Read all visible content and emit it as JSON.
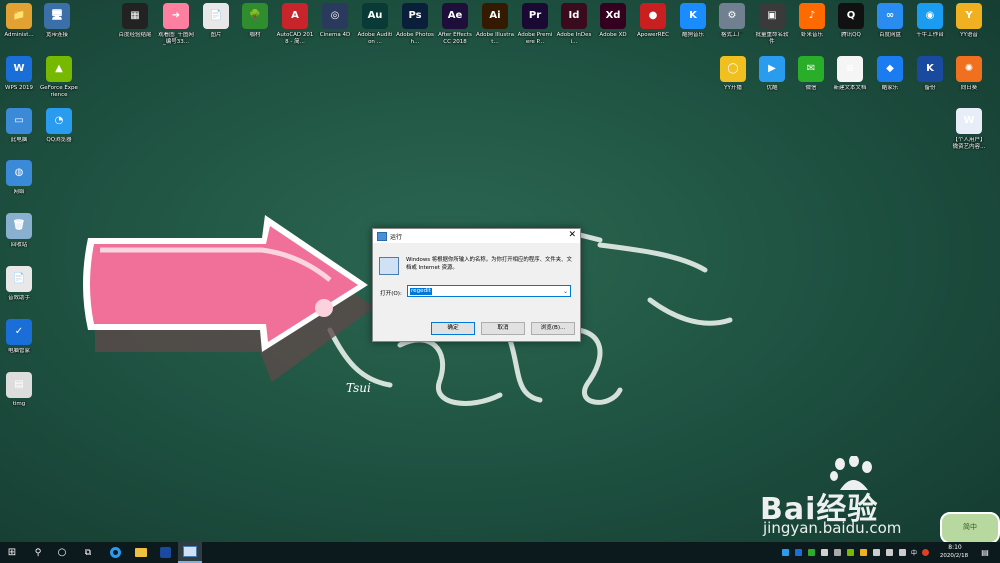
{
  "desktop": {
    "icons": [
      {
        "label": "Administ...",
        "glyph": "📁",
        "color": "#e2a233"
      },
      {
        "label": "宽带连接",
        "glyph": "🖥",
        "color": "#3b6fa8"
      },
      {
        "label": "百度经验结尾",
        "glyph": "▦",
        "color": "#222222"
      },
      {
        "label": "观看图_千图网_编号33...",
        "glyph": "➜",
        "color": "#ff7fa0"
      },
      {
        "label": "图片",
        "glyph": "📄",
        "color": "#e8e8e8"
      },
      {
        "label": "咖村",
        "glyph": "🌳",
        "color": "#2f8c2f"
      },
      {
        "label": "AutoCAD 2018 - 简...",
        "glyph": "A",
        "color": "#c8242c"
      },
      {
        "label": "Cinema 4D",
        "glyph": "◎",
        "color": "#2a3a5c"
      },
      {
        "label": "Adobe Audition ...",
        "glyph": "Au",
        "color": "#0a3a35"
      },
      {
        "label": "Adobe Photosh...",
        "glyph": "Ps",
        "color": "#0a1f3a"
      },
      {
        "label": "After Effects CC 2018",
        "glyph": "Ae",
        "color": "#1e0f3a"
      },
      {
        "label": "Adobe Illustrat...",
        "glyph": "Ai",
        "color": "#331a00"
      },
      {
        "label": "Adobe Premiere P...",
        "glyph": "Pr",
        "color": "#1a0a33"
      },
      {
        "label": "Adobe InDesi...",
        "glyph": "Id",
        "color": "#3a0a1e"
      },
      {
        "label": "Adobe XD",
        "glyph": "Xd",
        "color": "#33001f"
      },
      {
        "label": "ApowerREC",
        "glyph": "●",
        "color": "#c82020"
      },
      {
        "label": "酷狗音乐",
        "glyph": "K",
        "color": "#1a8cff"
      },
      {
        "label": "格式工厂",
        "glyph": "⚙",
        "color": "#708090"
      },
      {
        "label": "批量重命名软件",
        "glyph": "▣",
        "color": "#3a3a3a"
      },
      {
        "label": "虾米音乐",
        "glyph": "♪",
        "color": "#ff6a00"
      },
      {
        "label": "腾讯QQ",
        "glyph": "Q",
        "color": "#111111"
      },
      {
        "label": "百度网盘",
        "glyph": "∞",
        "color": "#2a8cf0"
      },
      {
        "label": "千牛工作台",
        "glyph": "◉",
        "color": "#1a9cf0"
      },
      {
        "label": "YY语音",
        "glyph": "Y",
        "color": "#f0b020"
      },
      {
        "label": "WPS 2019",
        "glyph": "W",
        "color": "#1a6ed8"
      },
      {
        "label": "GeForce Experience",
        "glyph": "▲",
        "color": "#76b900"
      },
      {
        "label": "YY开播",
        "glyph": "◯",
        "color": "#f0c020"
      },
      {
        "label": "优酷",
        "glyph": "▶",
        "color": "#2a9cf0"
      },
      {
        "label": "微信",
        "glyph": "✉",
        "color": "#2aae2a"
      },
      {
        "label": "新建文本文档",
        "glyph": "≡",
        "color": "#f5f5f5"
      },
      {
        "label": "酷家乐",
        "glyph": "◆",
        "color": "#1a7cf0"
      },
      {
        "label": "备份",
        "glyph": "K",
        "color": "#1a4aa0"
      },
      {
        "label": "向日葵",
        "glyph": "✺",
        "color": "#f07020"
      },
      {
        "label": "此电脑",
        "glyph": "▭",
        "color": "#3a8ad8"
      },
      {
        "label": "QQ浏览器",
        "glyph": "◔",
        "color": "#2a9cf0"
      },
      {
        "label": "【个人用户】微资艺内容...",
        "glyph": "W",
        "color": "#e8eef8"
      },
      {
        "label": "网络",
        "glyph": "◍",
        "color": "#3a8ad8"
      },
      {
        "label": "回收站",
        "glyph": "🗑",
        "color": "#8ab0d0"
      },
      {
        "label": "音效助手",
        "glyph": "📄",
        "color": "#e8e8e8"
      },
      {
        "label": "电脑管家",
        "glyph": "✓",
        "color": "#1a6ed8"
      },
      {
        "label": "timg",
        "glyph": "▤",
        "color": "#dddddd"
      }
    ],
    "signature": "Tsui"
  },
  "run_dialog": {
    "title": "运行",
    "close_glyph": "✕",
    "description": "Windows 将根据你所输入的名称，为你打开相应的程序、文件夹、文档或 Internet 资源。",
    "open_label": "打开(O):",
    "input_value": "regedit",
    "dropdown_glyph": "⌄",
    "ok_label": "确定",
    "cancel_label": "取消",
    "browse_label": "浏览(B)..."
  },
  "taskbar": {
    "start_glyph": "⊞",
    "search_glyph": "⚲",
    "cortana_glyph": "○",
    "taskview_glyph": "⧉",
    "tray_ime": "中",
    "clock_time": "8:10",
    "clock_date": "2020/2/18",
    "notification_glyph": "▤"
  },
  "watermark": {
    "text": "Bai经验",
    "url": "jingyan.baidu.com",
    "badge": "简中"
  }
}
